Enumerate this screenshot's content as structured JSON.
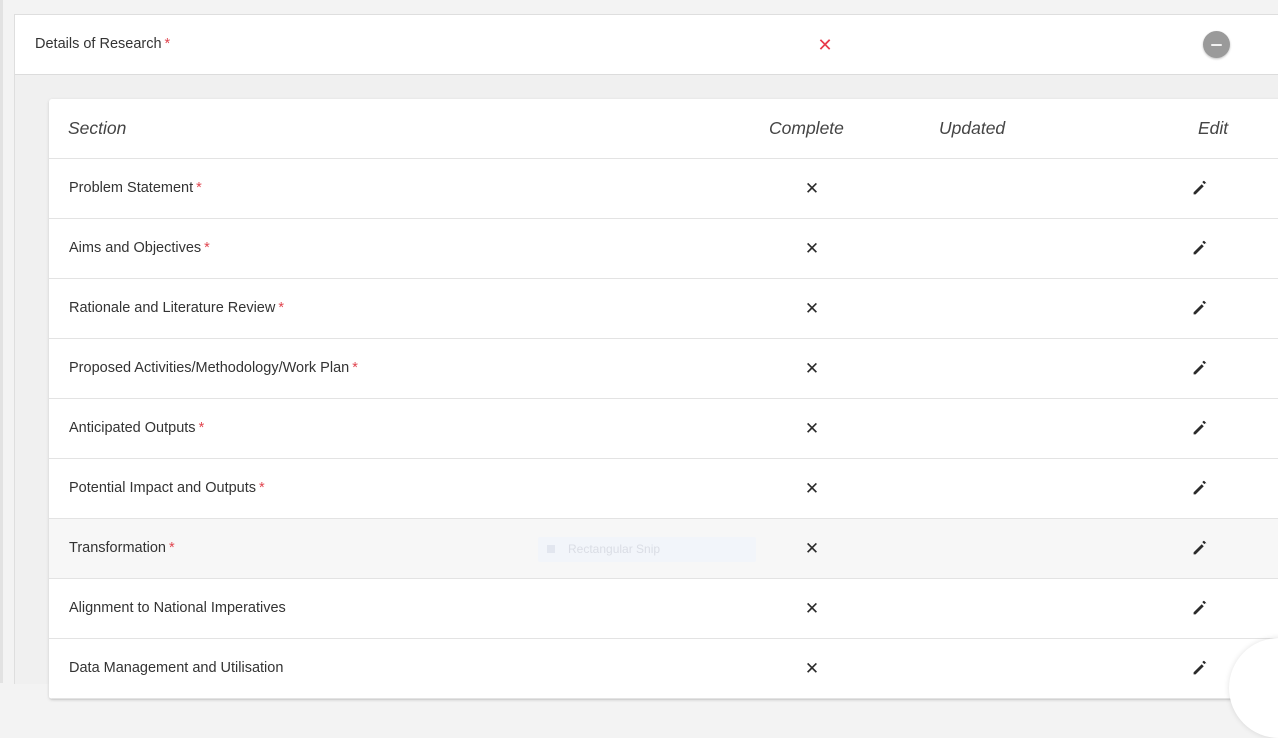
{
  "panel": {
    "title": "Details of Research",
    "required_mark": "*",
    "status_icon": "x-icon",
    "status_color": "#e8394a",
    "collapse_icon": "minus-circle-icon"
  },
  "table": {
    "headers": {
      "section": "Section",
      "complete": "Complete",
      "updated": "Updated",
      "edit": "Edit"
    },
    "rows": [
      {
        "label": "Problem Statement",
        "required": "*",
        "complete_icon": "x-icon",
        "updated": "",
        "edit_icon": "pencil-icon"
      },
      {
        "label": "Aims and Objectives",
        "required": "*",
        "complete_icon": "x-icon",
        "updated": "",
        "edit_icon": "pencil-icon"
      },
      {
        "label": "Rationale and Literature Review",
        "required": "*",
        "complete_icon": "x-icon",
        "updated": "",
        "edit_icon": "pencil-icon"
      },
      {
        "label": "Proposed Activities/Methodology/Work Plan",
        "required": "*",
        "complete_icon": "x-icon",
        "updated": "",
        "edit_icon": "pencil-icon"
      },
      {
        "label": "Anticipated Outputs",
        "required": "*",
        "complete_icon": "x-icon",
        "updated": "",
        "edit_icon": "pencil-icon"
      },
      {
        "label": "Potential Impact and Outputs",
        "required": "*",
        "complete_icon": "x-icon",
        "updated": "",
        "edit_icon": "pencil-icon"
      },
      {
        "label": "Transformation",
        "required": "*",
        "complete_icon": "x-icon",
        "updated": "",
        "edit_icon": "pencil-icon"
      },
      {
        "label": "Alignment to National Imperatives",
        "required": "",
        "complete_icon": "x-icon",
        "updated": "",
        "edit_icon": "pencil-icon"
      },
      {
        "label": "Data Management and Utilisation",
        "required": "",
        "complete_icon": "x-icon",
        "updated": "",
        "edit_icon": "pencil-icon"
      }
    ]
  },
  "overlay": {
    "snip_label": "Rectangular Snip"
  },
  "colors": {
    "required": "#e0454f",
    "icon_dark": "#2b2b2b"
  }
}
